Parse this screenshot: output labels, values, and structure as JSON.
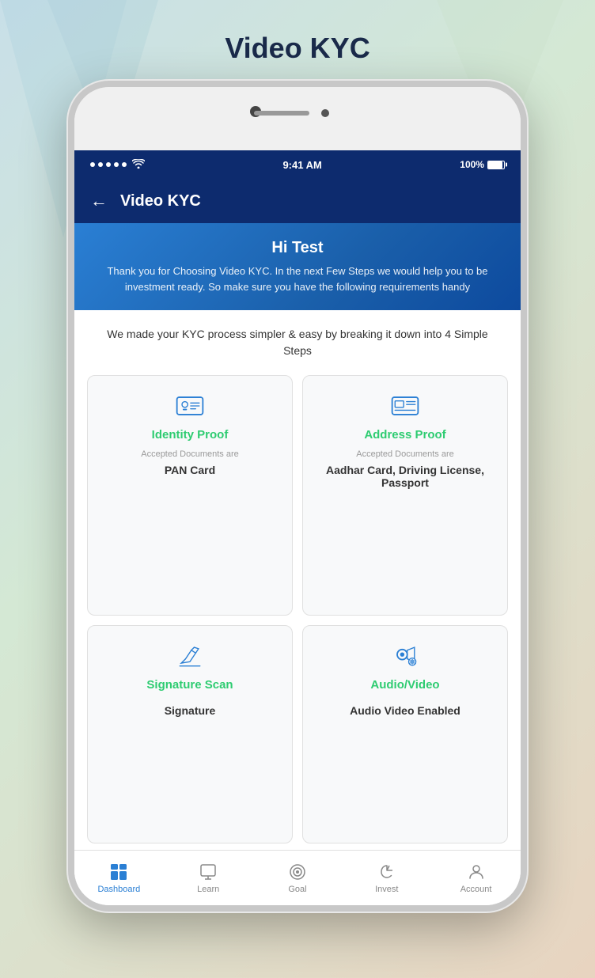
{
  "page": {
    "title": "Video KYC",
    "background_gradient_start": "#c8dfe8",
    "background_gradient_end": "#e8d4c0"
  },
  "status_bar": {
    "signal_dots": 5,
    "time": "9:41 AM",
    "battery": "100%"
  },
  "nav": {
    "back_label": "←",
    "title": "Video KYC"
  },
  "banner": {
    "greeting": "Hi Test",
    "description": "Thank you for Choosing Video KYC. In the next Few Steps we would help you to be investment ready. So make sure you have the following requirements handy"
  },
  "steps_text": "We made your KYC process simpler & easy by breaking it down into 4 Simple Steps",
  "cards": [
    {
      "id": "identity",
      "title": "Identity Proof",
      "subtitle": "Accepted Documents are",
      "value": "PAN Card",
      "icon": "id-card-icon"
    },
    {
      "id": "address",
      "title": "Address Proof",
      "subtitle": "Accepted Documents are",
      "value": "Aadhar Card, Driving License, Passport",
      "icon": "address-card-icon"
    },
    {
      "id": "signature",
      "title": "Signature Scan",
      "subtitle": "",
      "value": "Signature",
      "icon": "signature-icon"
    },
    {
      "id": "audiovideo",
      "title": "Audio/Video",
      "subtitle": "",
      "value": "Audio Video Enabled",
      "icon": "audio-video-icon"
    }
  ],
  "tabs": [
    {
      "id": "dashboard",
      "label": "Dashboard",
      "icon": "dashboard-icon",
      "active": true
    },
    {
      "id": "learn",
      "label": "Learn",
      "icon": "learn-icon",
      "active": false
    },
    {
      "id": "goal",
      "label": "Goal",
      "icon": "goal-icon",
      "active": false
    },
    {
      "id": "invest",
      "label": "Invest",
      "icon": "invest-icon",
      "active": false
    },
    {
      "id": "account",
      "label": "Account",
      "icon": "account-icon",
      "active": false
    }
  ]
}
